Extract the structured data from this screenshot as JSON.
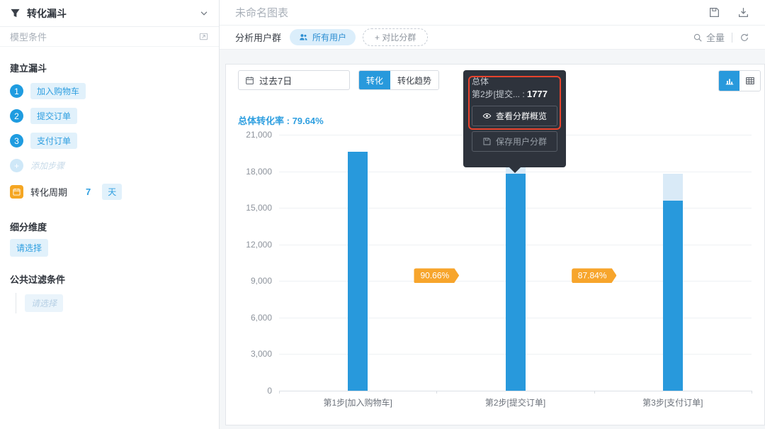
{
  "sidebar": {
    "title": "转化漏斗",
    "model_condition": "模型条件",
    "build_funnel": "建立漏斗",
    "steps": [
      {
        "num": "1",
        "label": "加入购物车"
      },
      {
        "num": "2",
        "label": "提交订单"
      },
      {
        "num": "3",
        "label": "支付订单"
      }
    ],
    "add_step_plus": "+",
    "add_step": "添加步骤",
    "period": {
      "label": "转化周期",
      "value": "7",
      "unit": "天"
    },
    "dimension_title": "细分维度",
    "dimension_placeholder": "请选择",
    "filter_title": "公共过滤条件",
    "filter_placeholder": "请选择"
  },
  "header": {
    "title": "未命名图表"
  },
  "toolbar": {
    "analyze_label": "分析用户群",
    "all_users": "所有用户",
    "compare": "+ 对比分群",
    "sampling": "全量"
  },
  "controls": {
    "date_range": "过去7日",
    "tab_conversion": "转化",
    "tab_trend": "转化趋势",
    "overall_label": "总体转化率 :",
    "overall_value": "79.64%"
  },
  "tooltip": {
    "title": "总体",
    "metric_label": "第2步[提交... :",
    "metric_value": "1777",
    "view_overview": "查看分群概览",
    "save_segment": "保存用户分群"
  },
  "chart_data": {
    "type": "bar",
    "title": "",
    "categories": [
      "第1步[加入购物车]",
      "第2步[提交订单]",
      "第3步[支付订单]"
    ],
    "series": [
      {
        "name": "上一步用户数(浅色)",
        "values": [
          null,
          19608,
          17777
        ]
      },
      {
        "name": "当前步用户数(深色)",
        "values": [
          19608,
          17777,
          15615
        ]
      }
    ],
    "step_conversion_rates": [
      "90.66%",
      "87.84%"
    ],
    "overall_conversion_rate": "79.64%",
    "xlabel": "",
    "ylabel": "",
    "ylim": [
      0,
      21000
    ],
    "yticks": [
      21000,
      18000,
      15000,
      12000,
      9000,
      6000,
      3000,
      0
    ],
    "ytick_labels": [
      "21,000",
      "18,000",
      "15,000",
      "12,000",
      "9,000",
      "6,000",
      "3,000",
      "0"
    ],
    "grid": true,
    "legend": false,
    "bar_color": "#2899dc",
    "bar_light_color": "#d9eaf7",
    "badge_color": "#f7a52c"
  },
  "colors": {
    "primary_blue": "#2899dc",
    "pill_blue_bg": "#e1f1fb",
    "orange": "#f5a623",
    "tooltip_bg": "#2e333c",
    "annotation_red": "#e8432d"
  }
}
